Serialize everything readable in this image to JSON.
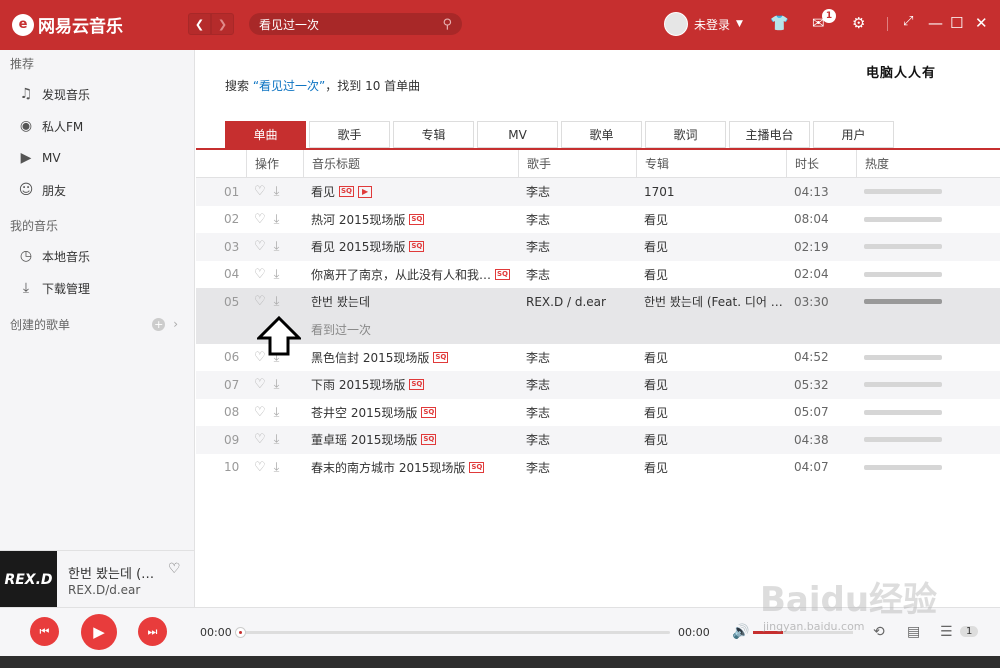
{
  "app": {
    "logo_text": "网易云音乐",
    "logo_symbol": "e"
  },
  "topbar": {
    "search_value": "看见过一次",
    "login_text": "未登录",
    "message_badge": "1",
    "icons": [
      "back-icon",
      "forward-icon",
      "search-icon",
      "skin-icon",
      "mail-icon",
      "settings-icon",
      "mini-mode-icon",
      "minimize-icon",
      "maximize-icon",
      "close-icon"
    ]
  },
  "sidebar": {
    "section_recommend": "推荐",
    "recommend_items": [
      {
        "label": "发现音乐",
        "icon": "♫"
      },
      {
        "label": "私人FM",
        "icon": "◉"
      },
      {
        "label": "MV",
        "icon": "▶"
      },
      {
        "label": "朋友",
        "icon": "☺"
      }
    ],
    "section_mymusic": "我的音乐",
    "mymusic_items": [
      {
        "label": "本地音乐",
        "icon": "◷"
      },
      {
        "label": "下载管理",
        "icon": "⤓"
      }
    ],
    "created_playlists": "创建的歌单"
  },
  "now_playing": {
    "title": "한번 봤는데 (…",
    "artist": "REX.D/d.ear",
    "cover_text": "REX.D"
  },
  "content": {
    "search_prefix": "搜索 ",
    "search_query": "“看见过一次”",
    "search_suffix": "，找到 10 首单曲",
    "watermark": "电脑人人有",
    "tabs": [
      "单曲",
      "歌手",
      "专辑",
      "MV",
      "歌单",
      "歌词",
      "主播电台",
      "用户"
    ],
    "active_tab": 0,
    "columns": {
      "op": "操作",
      "title": "音乐标题",
      "artist": "歌手",
      "album": "专辑",
      "duration": "时长",
      "hot": "热度"
    },
    "rows": [
      {
        "idx": "01",
        "title": "看见",
        "sq": true,
        "mv": true,
        "artist": "李志",
        "album": "1701",
        "duration": "04:13",
        "hot": 1.0
      },
      {
        "idx": "02",
        "title": "热河 2015现场版",
        "sq": true,
        "mv": false,
        "artist": "李志",
        "album": "看见",
        "duration": "08:04",
        "hot": 1.0
      },
      {
        "idx": "03",
        "title": "看见 2015现场版",
        "sq": true,
        "mv": false,
        "artist": "李志",
        "album": "看见",
        "duration": "02:19",
        "hot": 1.0
      },
      {
        "idx": "04",
        "title": "你离开了南京，从此没有人和我…",
        "sq": true,
        "mv": false,
        "artist": "李志",
        "album": "看见",
        "duration": "02:04",
        "hot": 1.0
      },
      {
        "idx": "05",
        "title": "한번 봤는데",
        "sq": false,
        "mv": false,
        "artist": "REX.D / d.ear",
        "album": "한번 봤는데 (Feat. 디어 (…",
        "duration": "03:30",
        "hot": 1.0,
        "selected": true,
        "lyric_match": "看到过一次"
      },
      {
        "idx": "06",
        "title": "黑色信封 2015现场版",
        "sq": true,
        "mv": false,
        "artist": "李志",
        "album": "看见",
        "duration": "04:52",
        "hot": 1.0
      },
      {
        "idx": "07",
        "title": "下雨 2015现场版",
        "sq": true,
        "mv": false,
        "artist": "李志",
        "album": "看见",
        "duration": "05:32",
        "hot": 1.0
      },
      {
        "idx": "08",
        "title": "苍井空 2015现场版",
        "sq": true,
        "mv": false,
        "artist": "李志",
        "album": "看见",
        "duration": "05:07",
        "hot": 1.0
      },
      {
        "idx": "09",
        "title": "董卓瑶 2015现场版",
        "sq": true,
        "mv": false,
        "artist": "李志",
        "album": "看见",
        "duration": "04:38",
        "hot": 1.0
      },
      {
        "idx": "10",
        "title": "春末的南方城市 2015现场版",
        "sq": true,
        "mv": false,
        "artist": "李志",
        "album": "看见",
        "duration": "04:07",
        "hot": 1.0
      }
    ]
  },
  "player": {
    "current_time": "00:00",
    "total_time": "00:00",
    "playlist_count": "1",
    "progress": 0.0,
    "volume": 0.3
  },
  "watermark": {
    "baidu": "Baidu经验",
    "baidu_sub": "jingyan.baidu.com"
  },
  "colors": {
    "brand_red": "#c62f2f",
    "sq_red": "#e03a3a"
  }
}
